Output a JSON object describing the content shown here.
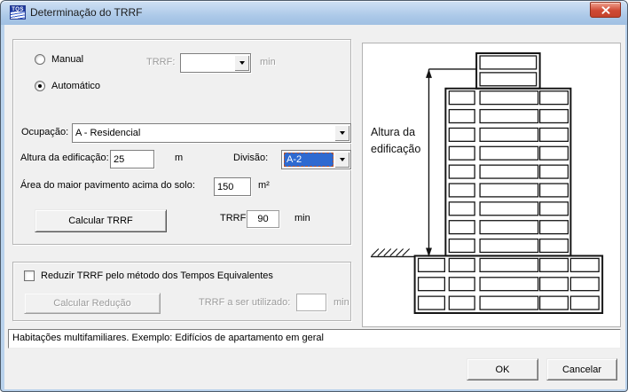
{
  "window": {
    "title": "Determinação do TRRF",
    "icon_text": "TQS"
  },
  "form": {
    "manual_label": "Manual",
    "auto_label": "Automático",
    "selected_mode": "auto",
    "trrf_manual": {
      "label": "TRRF:",
      "value": "",
      "unit": "min"
    },
    "ocupacao": {
      "label": "Ocupação:",
      "value": "A - Residencial"
    },
    "altura": {
      "label": "Altura da edificação:",
      "value": "25",
      "unit": "m"
    },
    "divisao": {
      "label": "Divisão:",
      "value": "A-2"
    },
    "area": {
      "label": "Área do maior pavimento acima do solo:",
      "value": "150",
      "unit": "m²"
    },
    "calc_button": "Calcular TRRF",
    "trrf_result": {
      "label": "TRRF:",
      "value": "90",
      "unit": "min"
    }
  },
  "reducao": {
    "checkbox_label": "Reduzir TRRF pelo método dos Tempos Equivalentes",
    "checked": false,
    "calc_button": "Calcular Redução",
    "trrf_util": {
      "label": "TRRF a ser utilizado:",
      "value": "",
      "unit": "min"
    }
  },
  "status": "Habitações multifamiliares. Exemplo: Edifícios de apartamento em geral",
  "diagram": {
    "label": "Altura da edificação",
    "top_floors": 2,
    "middle_floors": 9,
    "base_floors": 3
  },
  "footer": {
    "ok": "OK",
    "cancel": "Cancelar"
  },
  "colors": {
    "titlebar": "#abc8e8",
    "selection": "#2e6ad1",
    "close_button": "#cf4a35"
  }
}
